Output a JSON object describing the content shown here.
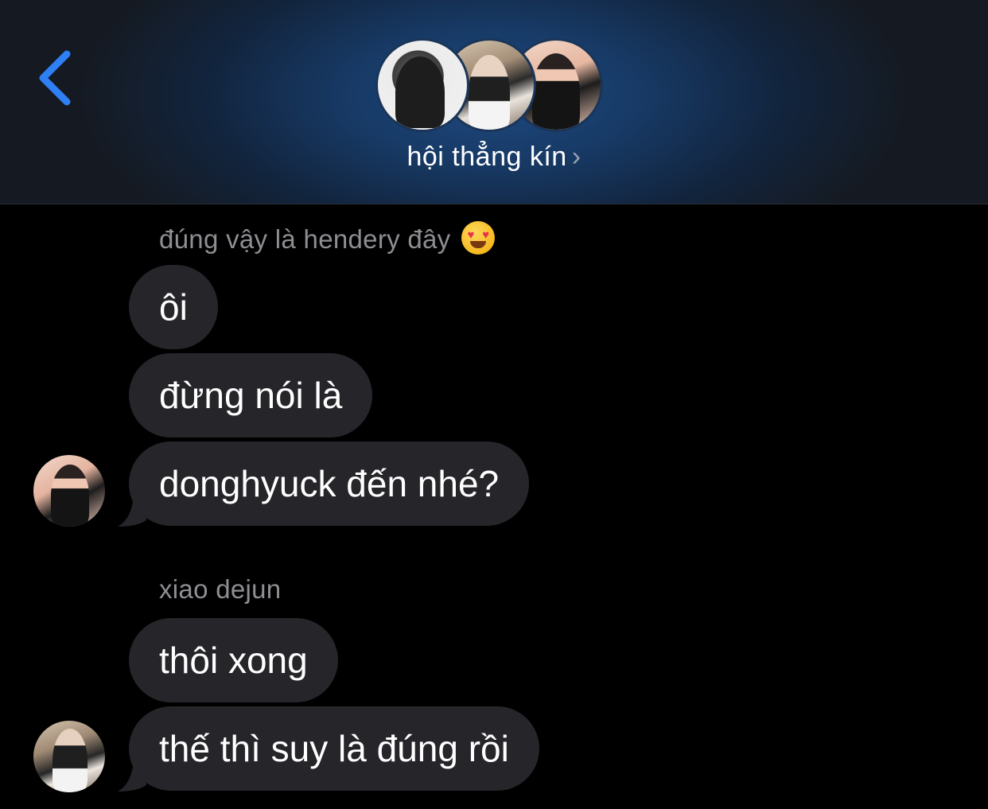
{
  "header": {
    "back_icon": "chevron-left-icon",
    "group_name": "hội thẳng kín",
    "title_chevron": "›",
    "accent_color": "#2f7ff5"
  },
  "messages": [
    {
      "sender": "đúng vậy là hendery đây",
      "sender_emoji": "heart-eyes-emoji",
      "bubbles": [
        "ôi",
        "đừng nói là",
        "donghyuck đến nhé?"
      ]
    },
    {
      "sender": "xiao dejun",
      "bubbles": [
        "thôi xong",
        "thế thì suy là đúng rồi"
      ]
    }
  ],
  "colors": {
    "bubble": "#26252a",
    "sender_text": "#8e8e93",
    "background": "#000000"
  }
}
